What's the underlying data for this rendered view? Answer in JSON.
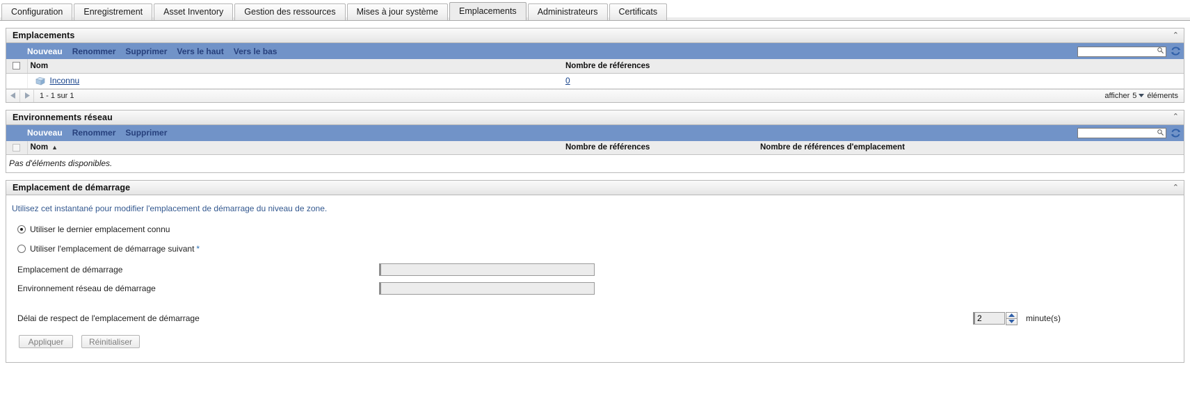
{
  "tabs": [
    {
      "label": "Configuration",
      "active": false
    },
    {
      "label": "Enregistrement",
      "active": false
    },
    {
      "label": "Asset Inventory",
      "active": false
    },
    {
      "label": "Gestion des ressources",
      "active": false
    },
    {
      "label": "Mises à jour système",
      "active": false
    },
    {
      "label": "Emplacements",
      "active": true
    },
    {
      "label": "Administrateurs",
      "active": false
    },
    {
      "label": "Certificats",
      "active": false
    }
  ],
  "panels": {
    "locations": {
      "title": "Emplacements",
      "collapse_icon": "⌃",
      "toolbar": {
        "actions": [
          "Nouveau",
          "Renommer",
          "Supprimer",
          "Vers le haut",
          "Vers le bas"
        ],
        "search_value": "",
        "search_placeholder": ""
      },
      "columns": [
        "Nom",
        "Nombre de références"
      ],
      "rows": [
        {
          "name": "Inconnu",
          "refcount": "0"
        }
      ],
      "pager": {
        "range": "1 - 1 sur 1",
        "show_label": "afficher",
        "page_size": "5",
        "items_label": "éléments"
      }
    },
    "network_envs": {
      "title": "Environnements réseau",
      "collapse_icon": "⌃",
      "toolbar": {
        "actions": [
          "Nouveau",
          "Renommer",
          "Supprimer"
        ],
        "search_value": "",
        "search_placeholder": ""
      },
      "columns": [
        "Nom",
        "Nombre de références",
        "Nombre de références d'emplacement"
      ],
      "sort_indicator": "▲",
      "empty_message": "Pas d'éléments disponibles."
    },
    "startup_location": {
      "title": "Emplacement de démarrage",
      "collapse_icon": "⌃",
      "hint": "Utilisez cet instantané pour modifier l'emplacement de démarrage du niveau de zone.",
      "radio_last_known": "Utiliser le dernier emplacement connu",
      "radio_following": "Utiliser l'emplacement de démarrage suivant",
      "required_marker": "*",
      "field_startup_location_label": "Emplacement de démarrage",
      "field_startup_location_value": "",
      "field_startup_network_label": "Environnement réseau de démarrage",
      "field_startup_network_value": "",
      "delay_label": "Délai de respect de l'emplacement de démarrage",
      "delay_value": "2",
      "delay_unit": "minute(s)",
      "apply_button": "Appliquer",
      "reset_button": "Réinitialiser"
    }
  },
  "colors": {
    "toolbar_blue": "#7193c8",
    "toolbar_link": "#27407c",
    "link": "#16428b",
    "hint": "#33588f"
  }
}
